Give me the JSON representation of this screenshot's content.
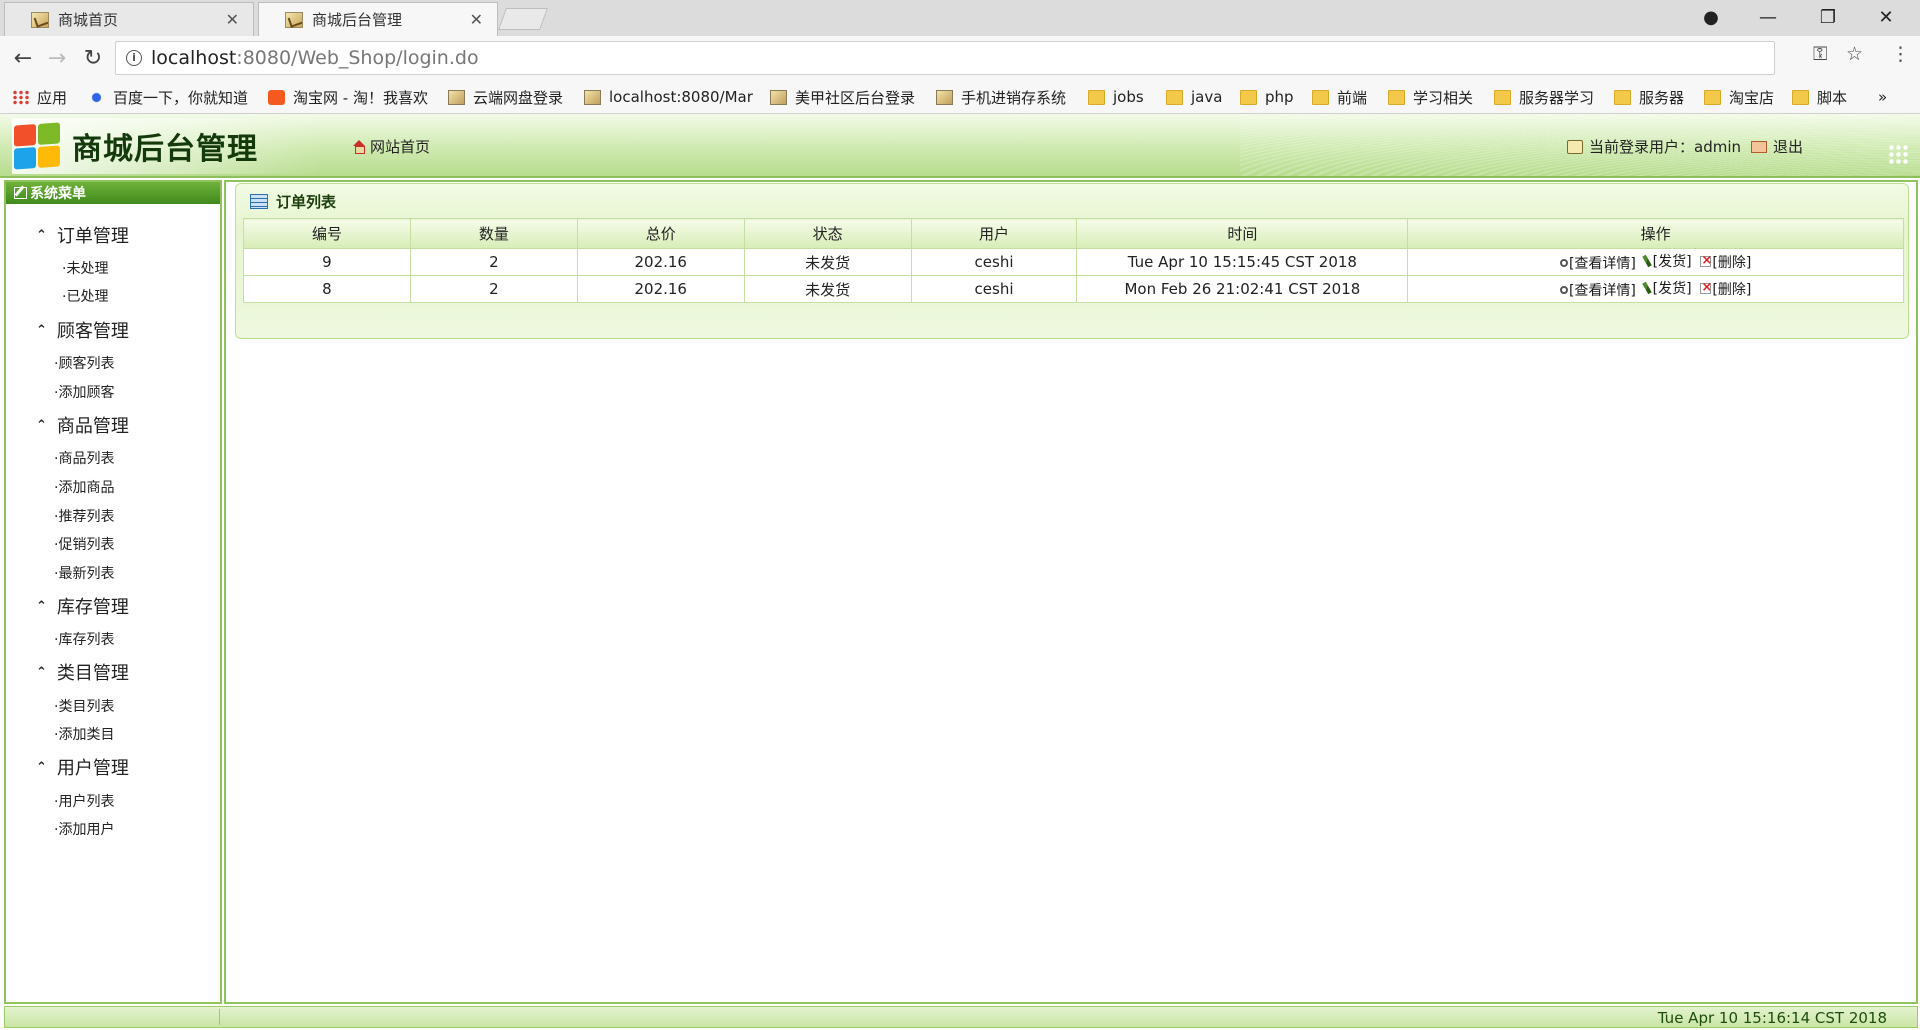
{
  "browser": {
    "tabs": [
      {
        "title": "商城首页"
      },
      {
        "title": "商城后台管理"
      }
    ],
    "url_host": "localhost",
    "url_rest": ":8080/Web_Shop/login.do",
    "bookmarks": [
      "应用",
      "百度一下，你就知道",
      "淘宝网 - 淘！我喜欢",
      "云端网盘登录",
      "localhost:8080/Mar",
      "美甲社区后台登录",
      "手机进销存系统",
      "jobs",
      "java",
      "php",
      "前端",
      "学习相关",
      "服务器学习",
      "服务器",
      "淘宝店",
      "脚本"
    ],
    "overflow": "»"
  },
  "header": {
    "title": "商城后台管理",
    "home_link": "网站首页",
    "login_label": "当前登录用户：admin",
    "logout": "退出"
  },
  "sidebar": {
    "title": "系统菜单",
    "groups": [
      {
        "label": "订单管理",
        "items": [
          "·未处理",
          "·已处理"
        ]
      },
      {
        "label": "顾客管理",
        "items": [
          "·顾客列表",
          "·添加顾客"
        ]
      },
      {
        "label": "商品管理",
        "items": [
          "·商品列表",
          "·添加商品",
          "·推荐列表",
          "·促销列表",
          "·最新列表"
        ]
      },
      {
        "label": "库存管理",
        "items": [
          "·库存列表"
        ]
      },
      {
        "label": "类目管理",
        "items": [
          "·类目列表",
          "·添加类目"
        ]
      },
      {
        "label": "用户管理",
        "items": [
          "·用户列表",
          "·添加用户"
        ]
      }
    ]
  },
  "orders": {
    "title": "订单列表",
    "columns": [
      "编号",
      "数量",
      "总价",
      "状态",
      "用户",
      "时间",
      "操作"
    ],
    "rows": [
      {
        "id": "9",
        "qty": "2",
        "total": "202.16",
        "status": "未发货",
        "user": "ceshi",
        "time": "Tue Apr 10 15:15:45 CST 2018"
      },
      {
        "id": "8",
        "qty": "2",
        "total": "202.16",
        "status": "未发货",
        "user": "ceshi",
        "time": "Mon Feb 26 21:02:41 CST 2018"
      }
    ],
    "actions": {
      "view": "[查看详情]",
      "ship": "[发货]",
      "delete": "[删除]"
    }
  },
  "status": {
    "time": "Tue Apr 10 15:16:14 CST 2018"
  }
}
